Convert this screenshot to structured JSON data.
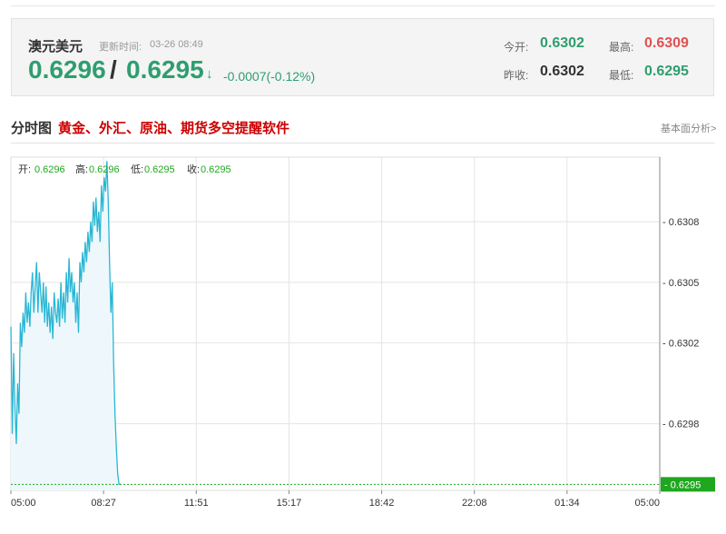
{
  "quote": {
    "name": "澳元美元",
    "update_label": "更新时间:",
    "update_time": "03-26 08:49",
    "bid": "0.6296",
    "separator": "/",
    "ask": "0.6295",
    "arrow": "↓",
    "change": "-0.0007(-0.12%)",
    "open_label": "今开:",
    "open_value": "0.6302",
    "high_label": "最高:",
    "high_value": "0.6309",
    "prev_close_label": "昨收:",
    "prev_close_value": "0.6302",
    "low_label": "最低:",
    "low_value": "0.6295"
  },
  "section": {
    "title": "分时图",
    "ad_text": "黄金、外汇、原油、期货多空提醒软件",
    "link_text": "基本面分析>"
  },
  "colors": {
    "green": "#2e9e6f",
    "red": "#e05050",
    "line": "#29b6d4",
    "fill": "#eef8fc",
    "marker": "#1fa81f"
  },
  "chart_data": {
    "type": "line",
    "ohlc": {
      "open_label": "开:",
      "open": "0.6296",
      "high_label": "高:",
      "high": "0.6296",
      "low_label": "低:",
      "low": "0.6295",
      "close_label": "收:",
      "close": "0.6295"
    },
    "x_ticks": [
      "05:00",
      "08:27",
      "11:51",
      "15:17",
      "18:42",
      "22:08",
      "01:34",
      "05:00"
    ],
    "y_ticks": [
      "0.6308",
      "0.6305",
      "0.6302",
      "0.6298"
    ],
    "y_range": [
      0.62947,
      0.63112
    ],
    "x_range_minutes": [
      0,
      1440
    ],
    "current_price": "0.6295",
    "current_value": 0.6295,
    "grid": true,
    "series": [
      {
        "x_minutes": [
          0,
          3,
          6,
          9,
          12,
          15,
          18,
          21,
          24,
          27,
          30,
          33,
          36,
          39,
          42,
          45,
          48,
          51,
          54,
          57,
          60,
          63,
          66,
          69,
          72,
          75,
          78,
          81,
          84,
          87,
          90,
          93,
          96,
          99,
          102,
          105,
          108,
          111,
          114,
          117,
          120,
          123,
          126,
          129,
          132,
          135,
          138,
          141,
          144,
          147,
          150,
          153,
          156,
          159,
          162,
          165,
          168,
          171,
          174,
          177,
          180,
          183,
          186,
          189,
          192,
          195,
          198,
          201,
          204,
          207,
          210,
          213,
          216,
          219,
          222,
          225,
          228,
          231,
          234,
          237,
          240,
          243
        ],
        "values": [
          0.63028,
          0.62975,
          0.63015,
          0.62988,
          0.6297,
          0.63,
          0.62985,
          0.6303,
          0.63018,
          0.63035,
          0.63025,
          0.63045,
          0.6303,
          0.6304,
          0.63028,
          0.63045,
          0.63055,
          0.63035,
          0.63048,
          0.6306,
          0.63035,
          0.63055,
          0.63045,
          0.63035,
          0.6305,
          0.6303,
          0.63048,
          0.63028,
          0.6304,
          0.63025,
          0.63038,
          0.63022,
          0.63045,
          0.63035,
          0.6303,
          0.63042,
          0.63028,
          0.6305,
          0.63032,
          0.63045,
          0.6303,
          0.63055,
          0.6304,
          0.63062,
          0.63045,
          0.63055,
          0.6304,
          0.6305,
          0.6303,
          0.63045,
          0.63025,
          0.6306,
          0.6305,
          0.63065,
          0.63055,
          0.6307,
          0.6306,
          0.63075,
          0.63065,
          0.6308,
          0.6307,
          0.6309,
          0.63078,
          0.63092,
          0.63075,
          0.63085,
          0.6307,
          0.63098,
          0.63085,
          0.63102,
          0.63095,
          0.6311,
          0.6309,
          0.6306,
          0.63035,
          0.6305,
          0.6301,
          0.62985,
          0.62968,
          0.62955,
          0.6295,
          0.6295
        ]
      }
    ]
  }
}
